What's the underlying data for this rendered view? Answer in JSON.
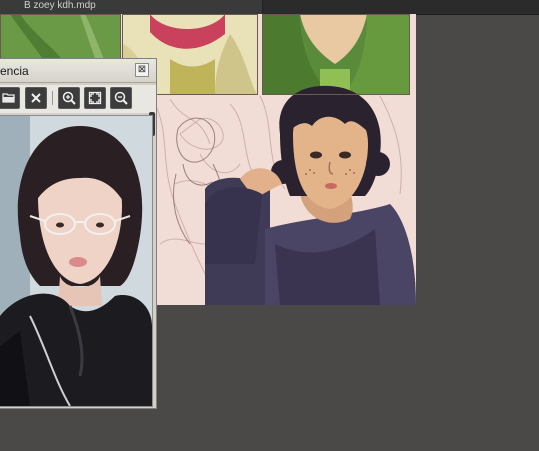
{
  "document_tab": {
    "title": "B zoey kdh.mdp"
  },
  "reference_window": {
    "title": "encia",
    "close_label": "⊠",
    "toolbar": {
      "open_icon": "folder-open-icon",
      "clear_icon": "close-x-icon",
      "zoom_in_icon": "zoom-in-icon",
      "fit_icon": "fit-window-icon",
      "zoom_out_icon": "zoom-out-icon"
    }
  },
  "colors": {
    "workspace": "#4a4948",
    "panel": "#d4d0c8",
    "toolbar_button": "#3c3c3c",
    "canvas_paper": "#f1dcd6"
  }
}
